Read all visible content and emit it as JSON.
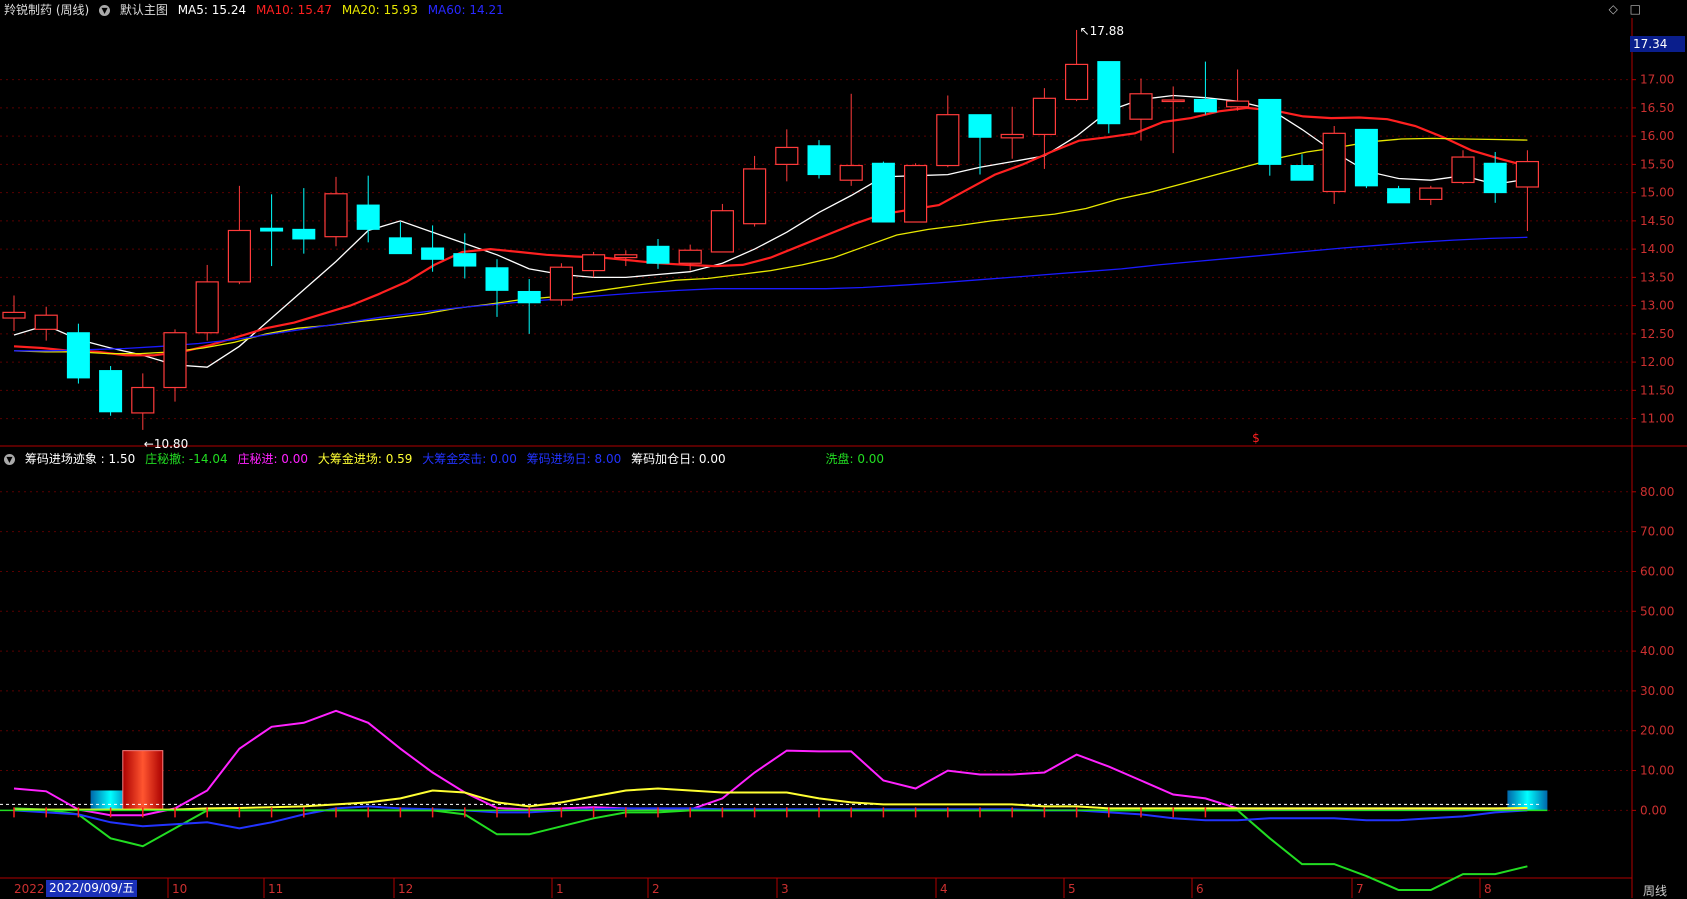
{
  "header": {
    "stock_name": "羚锐制药 (周线)",
    "main_chart_label": "默认主图",
    "ma5": "MA5: 15.24",
    "ma10": "MA10: 15.47",
    "ma20": "MA20: 15.93",
    "ma60": "MA60: 14.21"
  },
  "indicator_header": {
    "title": "筹码进场迹象 : 1.50",
    "zhuang_che": "庄秘撤: -14.04",
    "zhuang_jin": "庄秘进: 0.00",
    "da_chou_jin": "大筹金进场: 0.59",
    "da_chou_tu": "大筹金突击: 0.00",
    "chou_jin_ri": "筹码进场日: 8.00",
    "chou_he_ri": "筹码加仓日: 0.00",
    "xi_pan": "洗盘: 0.00"
  },
  "colors": {
    "up": "#ff3b3b",
    "down": "#00ffff",
    "ma5": "#ffffff",
    "ma10": "#ff2020",
    "ma20": "#e8e800",
    "ma60": "#1a1aff",
    "magenta": "#ff22ff",
    "green": "#22dd22",
    "yellow": "#ffff33",
    "blue": "#2233ff"
  },
  "icons": {
    "header_toggle": "chevron-down-icon",
    "corner": [
      "diamond-icon",
      "restore-icon"
    ]
  },
  "current_price_tag": "17.34",
  "high_label": "17.88",
  "low_label": "10.80",
  "marker_label": "$",
  "date_box": "2022/09/09/五",
  "x_prefix": "2022",
  "period": "周线",
  "chart_data": [
    {
      "type": "candlestick",
      "title": "羚锐制药 (周线)",
      "y_ticks": [
        "17.00",
        "16.50",
        "16.00",
        "15.50",
        "15.00",
        "14.50",
        "14.00",
        "13.50",
        "13.00",
        "12.50",
        "12.00",
        "11.50",
        "11.00"
      ],
      "ylim": [
        10.55,
        17.95
      ],
      "x_tick_labels": [
        "10",
        "11",
        "12",
        "1",
        "2",
        "3",
        "4",
        "5",
        "6",
        "7",
        "8"
      ],
      "candles": [
        {
          "o": 12.78,
          "h": 13.18,
          "l": 12.55,
          "c": 12.88
        },
        {
          "o": 12.58,
          "h": 12.98,
          "l": 12.38,
          "c": 12.83
        },
        {
          "o": 12.52,
          "h": 12.68,
          "l": 11.62,
          "c": 11.72
        },
        {
          "o": 11.85,
          "h": 11.93,
          "l": 11.05,
          "c": 11.12
        },
        {
          "o": 11.1,
          "h": 11.8,
          "l": 10.8,
          "c": 11.55
        },
        {
          "o": 11.55,
          "h": 12.58,
          "l": 11.3,
          "c": 12.52
        },
        {
          "o": 12.52,
          "h": 13.72,
          "l": 12.38,
          "c": 13.42
        },
        {
          "o": 13.42,
          "h": 15.12,
          "l": 13.38,
          "c": 14.33
        },
        {
          "o": 14.37,
          "h": 14.97,
          "l": 13.7,
          "c": 14.32
        },
        {
          "o": 14.35,
          "h": 15.08,
          "l": 13.92,
          "c": 14.18
        },
        {
          "o": 14.22,
          "h": 15.28,
          "l": 14.05,
          "c": 14.98
        },
        {
          "o": 14.78,
          "h": 15.3,
          "l": 14.12,
          "c": 14.35
        },
        {
          "o": 14.2,
          "h": 14.48,
          "l": 13.92,
          "c": 13.92
        },
        {
          "o": 14.02,
          "h": 14.42,
          "l": 13.6,
          "c": 13.82
        },
        {
          "o": 13.92,
          "h": 14.28,
          "l": 13.48,
          "c": 13.7
        },
        {
          "o": 13.67,
          "h": 13.82,
          "l": 12.8,
          "c": 13.27
        },
        {
          "o": 13.25,
          "h": 13.47,
          "l": 12.5,
          "c": 13.05
        },
        {
          "o": 13.1,
          "h": 13.75,
          "l": 13.0,
          "c": 13.68
        },
        {
          "o": 13.62,
          "h": 13.95,
          "l": 13.5,
          "c": 13.9
        },
        {
          "o": 13.85,
          "h": 13.98,
          "l": 13.7,
          "c": 13.9
        },
        {
          "o": 14.05,
          "h": 14.18,
          "l": 13.65,
          "c": 13.75
        },
        {
          "o": 13.75,
          "h": 14.08,
          "l": 13.62,
          "c": 13.98
        },
        {
          "o": 13.95,
          "h": 14.8,
          "l": 13.95,
          "c": 14.68
        },
        {
          "o": 14.45,
          "h": 15.65,
          "l": 14.4,
          "c": 15.42
        },
        {
          "o": 15.5,
          "h": 16.12,
          "l": 15.2,
          "c": 15.8
        },
        {
          "o": 15.83,
          "h": 15.93,
          "l": 15.25,
          "c": 15.32
        },
        {
          "o": 15.22,
          "h": 16.75,
          "l": 15.12,
          "c": 15.48
        },
        {
          "o": 15.52,
          "h": 15.55,
          "l": 14.48,
          "c": 14.48
        },
        {
          "o": 14.48,
          "h": 15.52,
          "l": 14.48,
          "c": 15.48
        },
        {
          "o": 15.48,
          "h": 16.72,
          "l": 15.45,
          "c": 16.38
        },
        {
          "o": 16.38,
          "h": 16.38,
          "l": 15.32,
          "c": 15.98
        },
        {
          "o": 15.97,
          "h": 16.52,
          "l": 15.6,
          "c": 16.03
        },
        {
          "o": 16.03,
          "h": 16.85,
          "l": 15.42,
          "c": 16.67
        },
        {
          "o": 16.65,
          "h": 17.88,
          "l": 16.62,
          "c": 17.27
        },
        {
          "o": 17.32,
          "h": 17.32,
          "l": 16.05,
          "c": 16.22
        },
        {
          "o": 16.3,
          "h": 17.02,
          "l": 15.92,
          "c": 16.75
        },
        {
          "o": 16.62,
          "h": 16.88,
          "l": 15.7,
          "c": 16.64
        },
        {
          "o": 16.65,
          "h": 17.32,
          "l": 16.38,
          "c": 16.43
        },
        {
          "o": 16.52,
          "h": 17.18,
          "l": 16.45,
          "c": 16.62
        },
        {
          "o": 16.65,
          "h": 16.65,
          "l": 15.3,
          "c": 15.5
        },
        {
          "o": 15.48,
          "h": 15.68,
          "l": 15.22,
          "c": 15.22
        },
        {
          "o": 15.02,
          "h": 16.18,
          "l": 14.8,
          "c": 16.05
        },
        {
          "o": 16.12,
          "h": 16.12,
          "l": 15.08,
          "c": 15.12
        },
        {
          "o": 15.07,
          "h": 15.12,
          "l": 14.82,
          "c": 14.82
        },
        {
          "o": 14.88,
          "h": 15.12,
          "l": 14.78,
          "c": 15.08
        },
        {
          "o": 15.18,
          "h": 15.75,
          "l": 15.15,
          "c": 15.63
        },
        {
          "o": 15.52,
          "h": 15.72,
          "l": 14.82,
          "c": 15.0
        },
        {
          "o": 15.1,
          "h": 15.75,
          "l": 14.32,
          "c": 15.55
        }
      ],
      "series": [
        {
          "name": "MA5",
          "values": [
            12.48,
            12.65,
            12.4,
            12.25,
            12.12,
            11.95,
            11.91,
            12.28,
            12.78,
            13.28,
            13.78,
            14.33,
            14.5,
            14.3,
            14.1,
            13.9,
            13.65,
            13.55,
            13.5,
            13.5,
            13.55,
            13.6,
            13.75,
            14.0,
            14.3,
            14.65,
            14.95,
            15.28,
            15.3,
            15.32,
            15.45,
            15.55,
            15.65,
            16.0,
            16.45,
            16.65,
            16.72,
            16.68,
            16.62,
            16.48,
            16.12,
            15.72,
            15.38,
            15.25,
            15.22,
            15.3,
            15.15,
            15.24
          ]
        },
        {
          "name": "MA10",
          "values": [
            12.28,
            12.25,
            12.2,
            12.18,
            12.12,
            12.12,
            12.18,
            12.3,
            12.45,
            12.6,
            12.7,
            12.85,
            13.0,
            13.2,
            13.42,
            13.72,
            13.95,
            14.0,
            13.95,
            13.9,
            13.87,
            13.85,
            13.8,
            13.75,
            13.72,
            13.7,
            13.72,
            13.85,
            14.05,
            14.25,
            14.45,
            14.62,
            14.7,
            14.78,
            15.05,
            15.32,
            15.5,
            15.72,
            15.92,
            15.98,
            16.05,
            16.25,
            16.32,
            16.44,
            16.5,
            16.45,
            16.35,
            16.32,
            16.33,
            16.3,
            16.18,
            15.98,
            15.75,
            15.6,
            15.47
          ]
        },
        {
          "name": "MA20",
          "values": [
            12.2,
            12.18,
            12.18,
            12.15,
            12.15,
            12.18,
            12.25,
            12.35,
            12.5,
            12.6,
            12.65,
            12.72,
            12.78,
            12.85,
            12.95,
            13.02,
            13.1,
            13.15,
            13.22,
            13.3,
            13.38,
            13.45,
            13.48,
            13.55,
            13.62,
            13.72,
            13.85,
            14.05,
            14.25,
            14.35,
            14.42,
            14.5,
            14.56,
            14.62,
            14.72,
            14.88,
            15.0,
            15.15,
            15.3,
            15.45,
            15.6,
            15.72,
            15.8,
            15.9,
            15.95,
            15.96,
            15.95,
            15.94,
            15.93
          ]
        },
        {
          "name": "MA60",
          "values": [
            12.2,
            12.2,
            12.22,
            12.24,
            12.28,
            12.33,
            12.4,
            12.5,
            12.6,
            12.7,
            12.8,
            12.88,
            12.96,
            13.02,
            13.08,
            13.13,
            13.18,
            13.23,
            13.27,
            13.3,
            13.3,
            13.3,
            13.3,
            13.32,
            13.36,
            13.4,
            13.45,
            13.5,
            13.55,
            13.6,
            13.65,
            13.72,
            13.78,
            13.84,
            13.9,
            13.96,
            14.02,
            14.07,
            14.12,
            14.16,
            14.19,
            14.21
          ]
        }
      ]
    },
    {
      "type": "line",
      "title": "筹码进场迹象",
      "y_ticks": [
        "80.00",
        "70.00",
        "60.00",
        "50.00",
        "40.00",
        "30.00",
        "20.00",
        "10.00",
        "0.00"
      ],
      "ylim": [
        -21.5,
        91.5
      ],
      "series": [
        {
          "name": "庄秘进",
          "values": [
            5.5,
            4.8,
            0.2,
            -1.2,
            -1.2,
            0.5,
            5.0,
            15.5,
            21.0,
            22.0,
            25.0,
            22.0,
            15.5,
            9.5,
            4.5,
            0.6,
            0.2,
            0.5,
            0.8,
            0.5,
            0.2,
            0.2,
            3.0,
            9.5,
            15.0,
            14.8,
            14.8,
            7.5,
            5.5,
            10.0,
            9.0,
            9.0,
            9.5,
            14.0,
            11.0,
            7.5,
            4.0,
            3.0,
            0.5,
            0.2,
            0.2,
            0.2,
            0.2,
            0.2,
            0.2,
            0.2,
            0.2,
            0.2
          ]
        },
        {
          "name": "庄秘撤",
          "values": [
            0.5,
            0.2,
            -1.0,
            -7.0,
            -9.0,
            -4.5,
            0.0,
            0.0,
            0.0,
            0.0,
            0.0,
            0.0,
            0.0,
            0.0,
            -1.0,
            -6.0,
            -6.0,
            -4.0,
            -2.0,
            -0.5,
            -0.5,
            0.0,
            0.0,
            0.0,
            0.0,
            0.0,
            0.0,
            0.0,
            0.0,
            0.0,
            0.0,
            0.0,
            0.0,
            0.0,
            0.0,
            0.0,
            0.0,
            0.0,
            0.0,
            -7.0,
            -13.5,
            -13.5,
            -16.5,
            -20.0,
            -20.0,
            -16.0,
            -16.0,
            -14.04
          ]
        },
        {
          "name": "大筹金进场",
          "values": [
            0.2,
            0.2,
            0.2,
            0.2,
            0.2,
            0.2,
            0.5,
            0.6,
            0.8,
            1.0,
            1.5,
            2.0,
            3.0,
            5.0,
            4.5,
            2.0,
            1.0,
            2.0,
            3.5,
            5.0,
            5.5,
            5.0,
            4.5,
            4.5,
            4.5,
            3.0,
            2.0,
            1.5,
            1.5,
            1.5,
            1.5,
            1.5,
            1.0,
            1.0,
            0.5,
            0.5,
            0.5,
            0.5,
            0.5,
            0.5,
            0.5,
            0.5,
            0.5,
            0.5,
            0.5,
            0.5,
            0.5,
            0.59
          ]
        },
        {
          "name": "大筹金突击",
          "values": [
            0.0,
            -0.5,
            -1.0,
            -3.0,
            -4.0,
            -3.5,
            -3.0,
            -4.5,
            -3.0,
            -1.0,
            0.5,
            1.0,
            0.5,
            0.3,
            0.0,
            -0.5,
            -0.5,
            0.0,
            0.3,
            0.5,
            0.5,
            0.5,
            0.3,
            0.3,
            0.3,
            0.3,
            0.3,
            0.3,
            0.3,
            0.3,
            0.3,
            0.3,
            0.0,
            0.0,
            -0.5,
            -1.0,
            -2.0,
            -2.5,
            -2.5,
            -2.0,
            -2.0,
            -2.0,
            -2.5,
            -2.5,
            -2.0,
            -1.5,
            -0.5,
            0.0
          ]
        }
      ],
      "bars": [
        {
          "index": 3,
          "value": 5.0,
          "color": "cyan"
        },
        {
          "index": 4,
          "value": 15.0,
          "color": "red"
        },
        {
          "index": 47,
          "value": 5.0,
          "color": "cyan"
        }
      ],
      "reference_value": 1.5
    }
  ]
}
